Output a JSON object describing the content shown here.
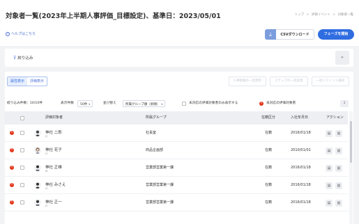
{
  "header": {
    "title": "対象者一覧(2023年上半期人事評価_目標設定)、基準日：2023/05/01",
    "breadcrumb": [
      "トップ",
      ">",
      "評価イベント",
      ">",
      "対象者一覧"
    ],
    "help_label": "ヘルプはこちら",
    "csv_download_label": "CSVダウンロード",
    "phase_start_label": "フェーズを開始"
  },
  "filter": {
    "label": "絞り込み"
  },
  "tabs": [
    "属性表示",
    "評価表示"
  ],
  "disabled_actions": [
    "人事情報の一括更新",
    "ステップの一括変更",
    "一括リマインド通知"
  ],
  "controls": {
    "filter_count": "絞り込み件数：10/10件",
    "display_count_label": "表示件数",
    "display_count_value": "50件",
    "sort_label": "並び替え",
    "sort_value": "所属グループ順（昇順）",
    "unhandled_only_label": "未対応の評価対象者のみ表示する",
    "unhandled_legend": "未対応の評価対象者",
    "page": "1"
  },
  "table": {
    "columns": [
      "評価対象者",
      "所属グループ",
      "在籍区分",
      "入社年月日",
      "アクション"
    ],
    "rows": [
      {
        "name": "神社 二郎",
        "sub": "J2",
        "group": "社長室",
        "status": "在籍",
        "joined": "2016/01/18"
      },
      {
        "name": "神社 花子",
        "sub": "J3",
        "group": "商品企画部",
        "status": "在籍",
        "joined": "2010/01/01"
      },
      {
        "name": "神社 正雄",
        "sub": "J8",
        "group": "営業部営業第一課",
        "status": "在籍",
        "joined": "2016/01/18"
      },
      {
        "name": "神社 みさえ",
        "sub": "J4",
        "group": "営業部営業第一課",
        "status": "在籍",
        "joined": "2016/01/18"
      },
      {
        "name": "神社 正一",
        "sub": "J5",
        "group": "営業部営業第一課",
        "status": "在籍",
        "joined": "2016/01/18"
      }
    ]
  },
  "colors": {
    "primary": "#2f6de1",
    "warning": "#e2361b",
    "link": "#4a6fd9"
  }
}
